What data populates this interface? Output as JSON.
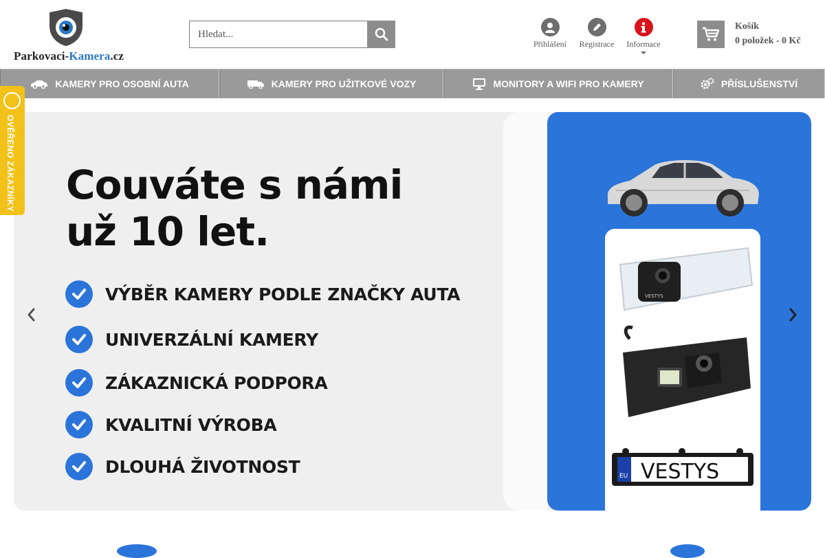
{
  "logo": {
    "text_main": "Parkovaci-",
    "text_accent": "Kamera",
    "text_tld": ".cz"
  },
  "search": {
    "placeholder": "Hledat...",
    "value": ""
  },
  "user_links": [
    {
      "label": "Přihlášení",
      "icon": "user-icon"
    },
    {
      "label": "Registrace",
      "icon": "pencil-icon"
    },
    {
      "label": "Informace",
      "icon": "info-icon"
    }
  ],
  "cart": {
    "title": "Košík",
    "summary": "0 položek - 0 Kč"
  },
  "nav": [
    {
      "label": "KAMERY PRO OSOBNÍ AUTA",
      "icon": "car-icon"
    },
    {
      "label": "KAMERY PRO UŽITKOVÉ VOZY",
      "icon": "truck-icon"
    },
    {
      "label": "MONITORY A WIFI PRO KAMERY",
      "icon": "monitor-icon"
    },
    {
      "label": "PŘÍSLUŠENSTVÍ",
      "icon": "gears-icon"
    }
  ],
  "badge": {
    "text": "OVĚŘENO ZÁKAZNÍKY"
  },
  "banner": {
    "headline_line1": "Couváte s námi",
    "headline_line2": "už 10 let.",
    "features": [
      "VÝBĚR KAMERY PODLE ZNAČKY AUTA",
      "UNIVERZÁLNÍ KAMERY",
      "ZÁKAZNICKÁ PODPORA",
      "KVALITNÍ VÝROBA",
      "DLOUHÁ ŽIVOTNOST"
    ],
    "plate_text": "VESTYS",
    "plate_eu": "EU",
    "camera_brand": "VESTYS"
  },
  "colors": {
    "accent": "#2b74d9",
    "nav_bg": "#9a9a9a",
    "badge": "#f2c21b",
    "info_red": "#d9121b"
  }
}
